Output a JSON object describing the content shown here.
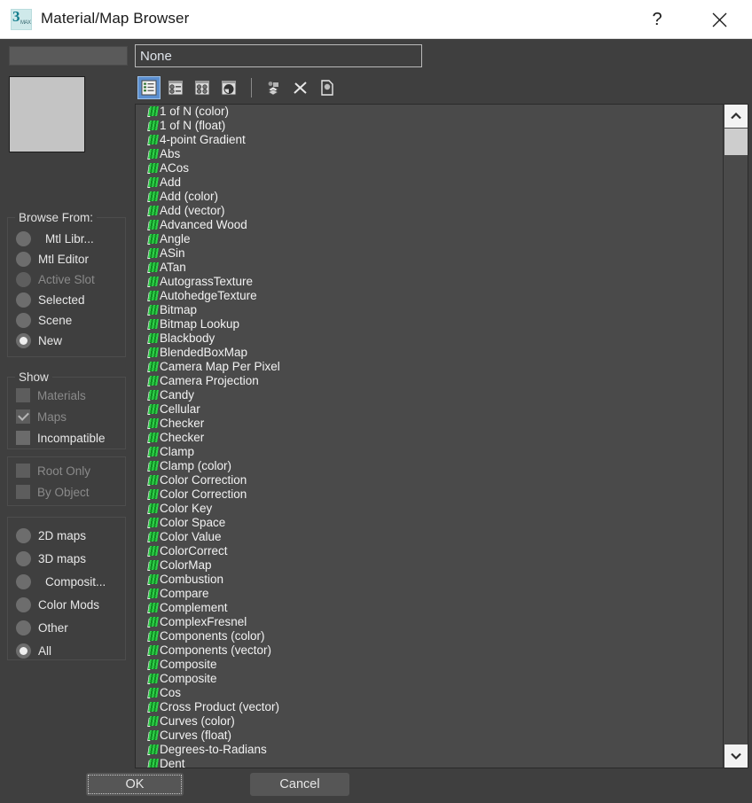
{
  "window": {
    "title": "Material/Map Browser",
    "app_icon": "3dsmax-icon",
    "help_label": "?",
    "close_label": "✕"
  },
  "left_panel": {
    "filter_input": {
      "value": "",
      "placeholder": ""
    },
    "preview_swatch_color": "#c4c4c4",
    "browse_from": {
      "title": "Browse From:",
      "options": [
        {
          "label": "Mtl Libr...",
          "selected": false,
          "disabled": false,
          "indent": true
        },
        {
          "label": "Mtl Editor",
          "selected": false,
          "disabled": false,
          "indent": false
        },
        {
          "label": "Active Slot",
          "selected": false,
          "disabled": true,
          "indent": false
        },
        {
          "label": "Selected",
          "selected": false,
          "disabled": false,
          "indent": false
        },
        {
          "label": "Scene",
          "selected": false,
          "disabled": false,
          "indent": false
        },
        {
          "label": "New",
          "selected": true,
          "disabled": false,
          "indent": false
        }
      ]
    },
    "show": {
      "title": "Show",
      "options": [
        {
          "label": "Materials",
          "checked": false,
          "disabled": true
        },
        {
          "label": "Maps",
          "checked": true,
          "disabled": true
        },
        {
          "label": "Incompatible",
          "checked": false,
          "disabled": false
        }
      ]
    },
    "scope": {
      "options": [
        {
          "label": "Root Only",
          "checked": false,
          "disabled": true
        },
        {
          "label": "By Object",
          "checked": false,
          "disabled": true
        }
      ]
    },
    "categories": {
      "options": [
        {
          "label": "2D maps",
          "selected": false,
          "disabled": false,
          "indent": false
        },
        {
          "label": "3D maps",
          "selected": false,
          "disabled": false,
          "indent": false
        },
        {
          "label": "Composit...",
          "selected": false,
          "disabled": false,
          "indent": true
        },
        {
          "label": "Color Mods",
          "selected": false,
          "disabled": false,
          "indent": false
        },
        {
          "label": "Other",
          "selected": false,
          "disabled": false,
          "indent": false
        },
        {
          "label": "All",
          "selected": true,
          "disabled": false,
          "indent": false
        }
      ]
    }
  },
  "name_field": {
    "value": "None",
    "placeholder": ""
  },
  "toolbar": {
    "buttons": [
      {
        "icon": "list-view-icon",
        "label": "View List",
        "selected": true
      },
      {
        "icon": "list-with-icons-view-icon",
        "label": "View List + Icons",
        "selected": false
      },
      {
        "icon": "small-icons-view-icon",
        "label": "View Small Icons",
        "selected": false
      },
      {
        "icon": "large-icons-view-icon",
        "label": "View Large Icons",
        "selected": false
      },
      {
        "icon": "separator",
        "label": "",
        "selected": false
      },
      {
        "icon": "update-scene-materials-icon",
        "label": "Update Scene Materials from Library",
        "selected": false
      },
      {
        "icon": "clear-material-library-icon",
        "label": "Clear Material Library",
        "selected": false
      },
      {
        "icon": "new-material-library-icon",
        "label": "New Material Library",
        "selected": false
      }
    ]
  },
  "list": {
    "items": [
      "1 of N (color)",
      "1 of N (float)",
      "4-point Gradient",
      "Abs",
      "ACos",
      "Add",
      "Add (color)",
      "Add (vector)",
      "Advanced Wood",
      "Angle",
      "ASin",
      "ATan",
      "AutograssTexture",
      "AutohedgeTexture",
      "Bitmap",
      "Bitmap Lookup",
      "Blackbody",
      "BlendedBoxMap",
      "Camera Map Per Pixel",
      "Camera Projection",
      "Candy",
      "Cellular",
      "Checker",
      "Checker",
      "Clamp",
      "Clamp (color)",
      "Color Correction",
      "Color Correction",
      "Color Key",
      "Color Space",
      "Color Value",
      "ColorCorrect",
      "ColorMap",
      "Combustion",
      "Compare",
      "Complement",
      "ComplexFresnel",
      "Components (color)",
      "Components (vector)",
      "Composite",
      "Composite",
      "Cos",
      "Cross Product (vector)",
      "Curves (color)",
      "Curves (float)",
      "Degrees-to-Radians",
      "Dent"
    ],
    "item_icon": "map-swatch-icon"
  },
  "scrollbar": {
    "up_arrow": "chevron-up-icon",
    "down_arrow": "chevron-down-icon"
  },
  "footer": {
    "ok_label": "OK",
    "cancel_label": "Cancel"
  },
  "colors": {
    "dialog_bg": "#3f3f3f",
    "list_bg": "#4a4a4a",
    "accent_selected": "#5b8fd0",
    "text": "#e8e8e8",
    "icon_green": "#22b83a"
  }
}
